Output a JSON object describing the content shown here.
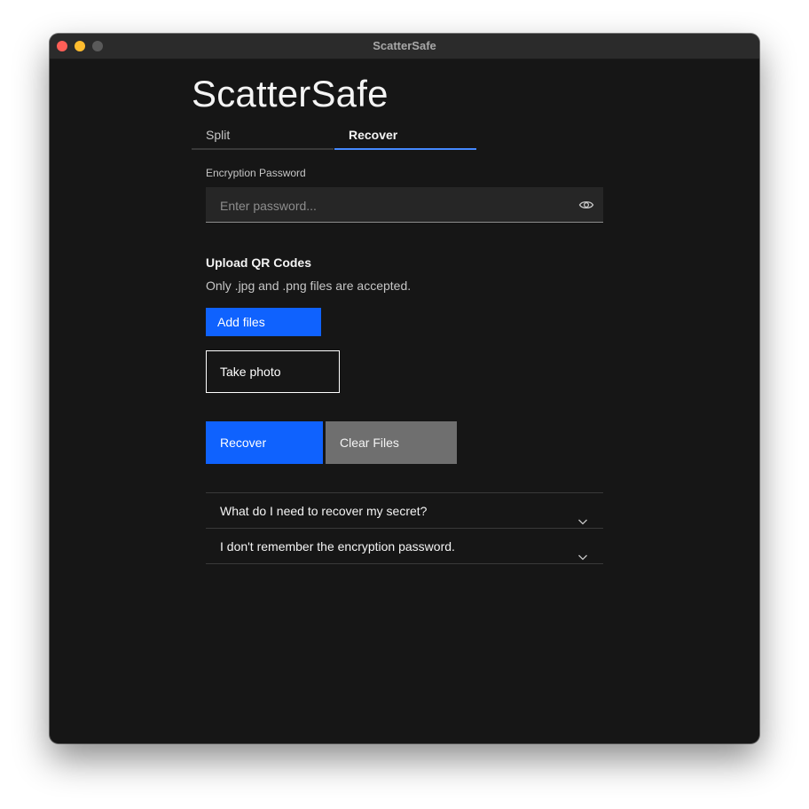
{
  "window": {
    "title": "ScatterSafe"
  },
  "app": {
    "title": "ScatterSafe"
  },
  "tabs": [
    {
      "label": "Split",
      "selected": false
    },
    {
      "label": "Recover",
      "selected": true
    }
  ],
  "password": {
    "label": "Encryption Password",
    "placeholder": "Enter password...",
    "value": "",
    "toggle_icon": "eye-icon"
  },
  "upload": {
    "heading": "Upload QR Codes",
    "help": "Only .jpg and .png files are accepted.",
    "add_files_label": "Add files",
    "take_photo_label": "Take photo"
  },
  "actions": {
    "recover_label": "Recover",
    "clear_label": "Clear Files"
  },
  "accordion": [
    {
      "label": "What do I need to recover my secret?",
      "icon": "chevron-down-icon"
    },
    {
      "label": "I don't remember the encryption password.",
      "icon": "chevron-down-icon"
    }
  ],
  "colors": {
    "background": "#161616",
    "accent": "#0f62fe",
    "tab_underline": "#4589ff",
    "secondary_button": "#6f6f6f"
  }
}
